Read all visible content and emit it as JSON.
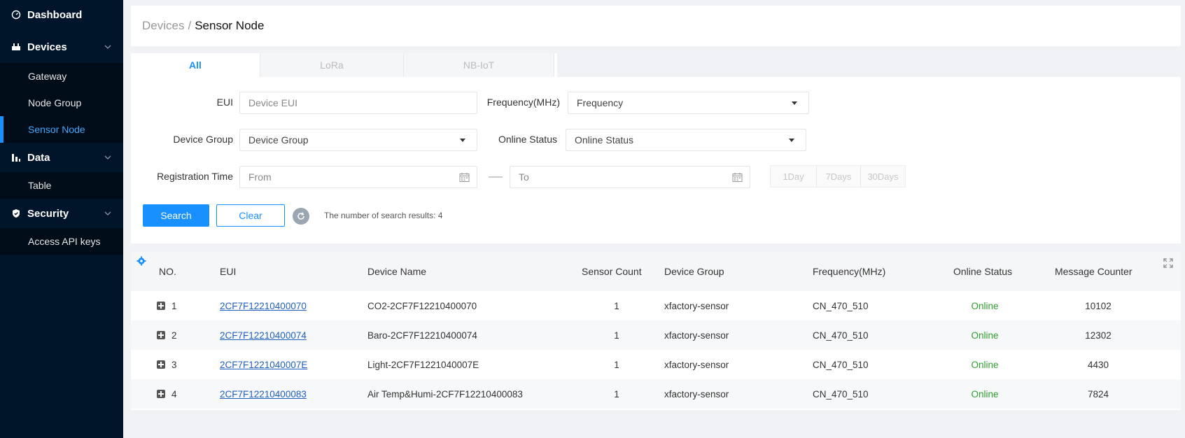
{
  "sidebar": {
    "dashboard": "Dashboard",
    "devices": "Devices",
    "devices_items": [
      "Gateway",
      "Node Group",
      "Sensor Node"
    ],
    "data": "Data",
    "data_items": [
      "Table"
    ],
    "security": "Security",
    "security_items": [
      "Access API keys"
    ]
  },
  "breadcrumb": {
    "parent": "Devices",
    "separator": "/",
    "current": "Sensor Node"
  },
  "tabs": [
    "All",
    "LoRa",
    "NB-IoT"
  ],
  "filters": {
    "eui_label": "EUI",
    "eui_placeholder": "Device EUI",
    "frequency_label": "Frequency(MHz)",
    "frequency_value": "Frequency",
    "group_label": "Device Group",
    "group_value": "Device Group",
    "status_label": "Online Status",
    "status_value": "Online Status",
    "time_label": "Registration Time",
    "from_placeholder": "From",
    "to_placeholder": "To",
    "quick": [
      "1Day",
      "7Days",
      "30Days"
    ]
  },
  "actions": {
    "search": "Search",
    "clear": "Clear",
    "result_text": "The number of search results: 4"
  },
  "table": {
    "headers": [
      "NO.",
      "EUI",
      "Device Name",
      "Sensor Count",
      "Device Group",
      "Frequency(MHz)",
      "Online Status",
      "Message Counter"
    ],
    "rows": [
      {
        "no": "1",
        "eui": "2CF7F12210400070",
        "name": "CO2-2CF7F12210400070",
        "count": "1",
        "group": "xfactory-sensor",
        "freq": "CN_470_510",
        "status": "Online",
        "messages": "10102"
      },
      {
        "no": "2",
        "eui": "2CF7F12210400074",
        "name": "Baro-2CF7F12210400074",
        "count": "1",
        "group": "xfactory-sensor",
        "freq": "CN_470_510",
        "status": "Online",
        "messages": "12302"
      },
      {
        "no": "3",
        "eui": "2CF7F1221040007E",
        "name": "Light-2CF7F1221040007E",
        "count": "1",
        "group": "xfactory-sensor",
        "freq": "CN_470_510",
        "status": "Online",
        "messages": "4430"
      },
      {
        "no": "4",
        "eui": "2CF7F12210400083",
        "name": "Air Temp&Humi-2CF7F12210400083",
        "count": "1",
        "group": "xfactory-sensor",
        "freq": "CN_470_510",
        "status": "Online",
        "messages": "7824"
      }
    ]
  },
  "colors": {
    "primary": "#1890ff",
    "sidebar_bg": "#001529",
    "online": "#2e9e2e"
  }
}
